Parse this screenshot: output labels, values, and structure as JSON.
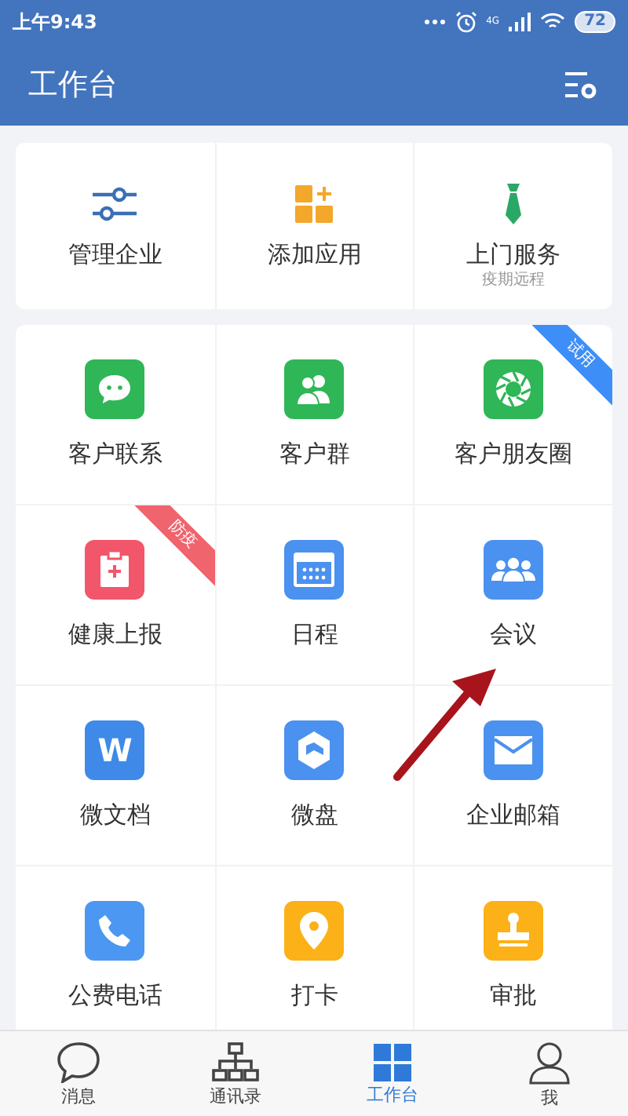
{
  "status_bar": {
    "time": "上午9:43",
    "network": "4G",
    "battery": "72"
  },
  "header": {
    "title": "工作台"
  },
  "top_actions": [
    {
      "kind": "sliders",
      "label": "管理企业"
    },
    {
      "kind": "add-app",
      "label": "添加应用"
    },
    {
      "kind": "tie",
      "label": "上门服务",
      "subtitle": "疫期远程"
    }
  ],
  "apps": [
    {
      "kind": "chat",
      "label": "客户联系",
      "color": "#2fb657"
    },
    {
      "kind": "group",
      "label": "客户群",
      "color": "#2fb657"
    },
    {
      "kind": "aperture",
      "label": "客户朋友圈",
      "color": "#2fb657",
      "ribbon": {
        "text": "试用",
        "color": "#3e8ef7"
      }
    },
    {
      "kind": "clipboard",
      "label": "健康上报",
      "color": "#f2566a",
      "ribbon": {
        "text": "防疫",
        "color": "#f0646d"
      }
    },
    {
      "kind": "calendar",
      "label": "日程",
      "color": "#4b91ef"
    },
    {
      "kind": "meeting",
      "label": "会议",
      "color": "#4b91ef"
    },
    {
      "kind": "doc",
      "label": "微文档",
      "color": "#3f8ae8",
      "glyph": "W"
    },
    {
      "kind": "disk",
      "label": "微盘",
      "color": "#4b91ef"
    },
    {
      "kind": "mail",
      "label": "企业邮箱",
      "color": "#4b91ef"
    },
    {
      "kind": "phone",
      "label": "公费电话",
      "color": "#4b97f2"
    },
    {
      "kind": "pin",
      "label": "打卡",
      "color": "#fbb117"
    },
    {
      "kind": "stamp",
      "label": "审批",
      "color": "#fbb117"
    }
  ],
  "tab_bar": [
    {
      "kind": "chat",
      "label": "消息",
      "selected": false
    },
    {
      "kind": "org",
      "label": "通讯录",
      "selected": false
    },
    {
      "kind": "grid",
      "label": "工作台",
      "selected": true
    },
    {
      "kind": "person",
      "label": "我",
      "selected": false
    }
  ]
}
